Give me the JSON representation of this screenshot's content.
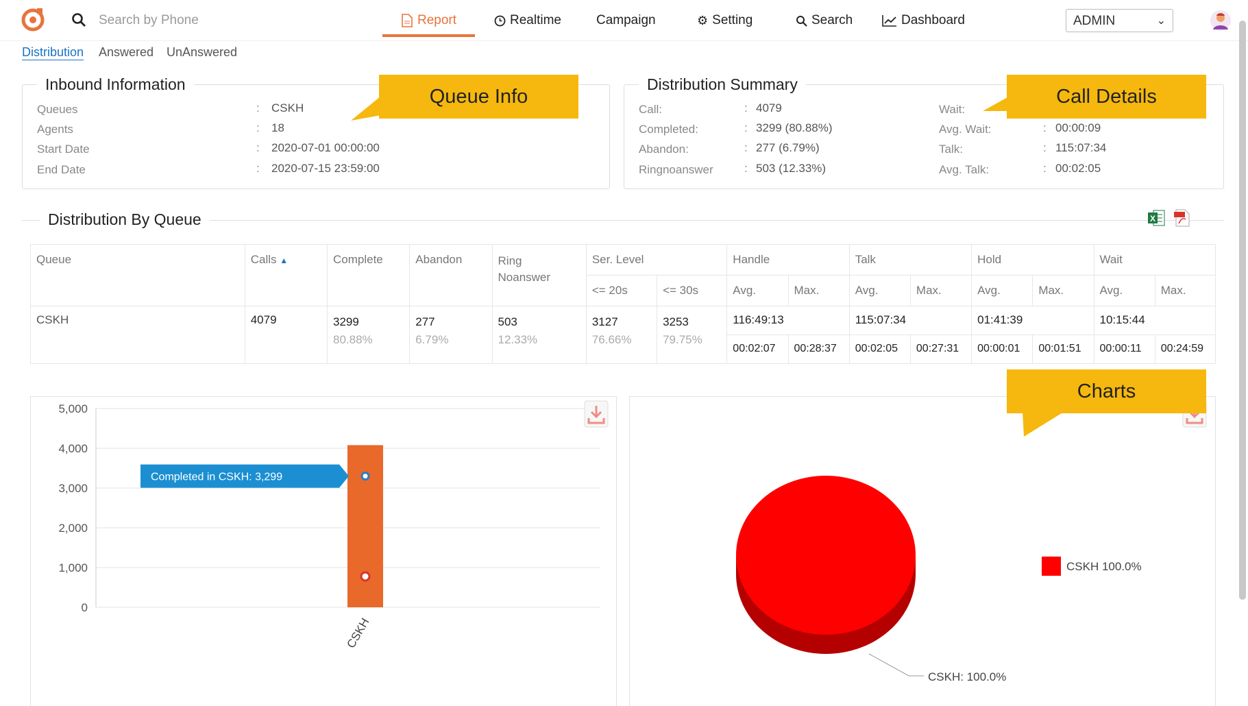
{
  "topbar": {
    "search_placeholder": "Search by Phone",
    "nav": [
      {
        "label": "Report",
        "icon": "report-doc-icon",
        "active": true
      },
      {
        "label": "Realtime",
        "icon": "clock-icon",
        "active": false
      },
      {
        "label": "Campaign",
        "icon": "",
        "active": false
      },
      {
        "label": "Setting",
        "icon": "gear-icon",
        "active": false
      },
      {
        "label": "Search",
        "icon": "search-icon",
        "active": false
      },
      {
        "label": "Dashboard",
        "icon": "line-chart-icon",
        "active": false
      }
    ],
    "user_select": "ADMIN",
    "accent_color": "#e8743b"
  },
  "subtabs": [
    "Distribution",
    "Answered",
    "UnAnswered"
  ],
  "inbound": {
    "title": "Inbound Information",
    "rows": [
      {
        "label": "Queues",
        "value": "CSKH"
      },
      {
        "label": "Agents",
        "value": "18"
      },
      {
        "label": "Start Date",
        "value": "2020-07-01 00:00:00"
      },
      {
        "label": "End Date",
        "value": "2020-07-15 23:59:00"
      }
    ]
  },
  "summary": {
    "title": "Distribution Summary",
    "left": [
      {
        "label": "Call:",
        "value": "4079"
      },
      {
        "label": "Completed:",
        "value": "3299 (80.88%)"
      },
      {
        "label": "Abandon:",
        "value": "277 (6.79%)"
      },
      {
        "label": "Ringnoanswer",
        "value": "503 (12.33%)"
      }
    ],
    "right": [
      {
        "label": "Wait:",
        "value": ""
      },
      {
        "label": "Avg. Wait:",
        "value": "00:00:09"
      },
      {
        "label": "Talk:",
        "value": "115:07:34"
      },
      {
        "label": "Avg. Talk:",
        "value": "00:02:05"
      }
    ]
  },
  "callouts": {
    "queue_info": "Queue Info",
    "call_details": "Call Details",
    "charts": "Charts"
  },
  "queue_table": {
    "title": "Distribution By Queue",
    "headers": {
      "queue": "Queue",
      "calls": "Calls",
      "complete": "Complete",
      "abandon": "Abandon",
      "ring1": "Ring",
      "ring2": "Noanswer",
      "ser_level": "Ser. Level",
      "le20": "<= 20s",
      "le30": "<= 30s",
      "handle": "Handle",
      "talk": "Talk",
      "hold": "Hold",
      "wait": "Wait",
      "avg": "Avg.",
      "max": "Max."
    },
    "row": {
      "queue": "CSKH",
      "calls": "4079",
      "complete": "3299",
      "complete_pct": "80.88%",
      "abandon": "277",
      "abandon_pct": "6.79%",
      "ring": "503",
      "ring_pct": "12.33%",
      "le20": "3127",
      "le20_pct": "76.66%",
      "le30": "3253",
      "le30_pct": "79.75%",
      "handle_total": "116:49:13",
      "handle_avg": "00:02:07",
      "handle_max": "00:28:37",
      "talk_total": "115:07:34",
      "talk_avg": "00:02:05",
      "talk_max": "00:27:31",
      "hold_total": "01:41:39",
      "hold_avg": "00:00:01",
      "hold_max": "00:01:51",
      "wait_total": "10:15:44",
      "wait_avg": "00:00:11",
      "wait_max": "00:24:59"
    }
  },
  "chart_data": [
    {
      "type": "bar",
      "categories": [
        "CSKH"
      ],
      "series": [
        {
          "values": [
            4079
          ],
          "color": "#e8692a"
        }
      ],
      "point": {
        "category": "CSKH",
        "value": 3299
      },
      "tooltip": "Completed in CSKH: 3,299",
      "ylim": [
        0,
        5000
      ],
      "yticks": [
        "5,000",
        "4,000",
        "3,000",
        "2,000",
        "1,000",
        "0"
      ],
      "grid": true
    },
    {
      "type": "pie",
      "slices": [
        {
          "label": "CSKH",
          "value": 100.0,
          "color": "#ff0000"
        }
      ],
      "slice_label": "CSKH: 100.0%",
      "legend": [
        {
          "label": "CSKH",
          "value": "100.0%"
        }
      ],
      "legend_position": "right"
    }
  ]
}
